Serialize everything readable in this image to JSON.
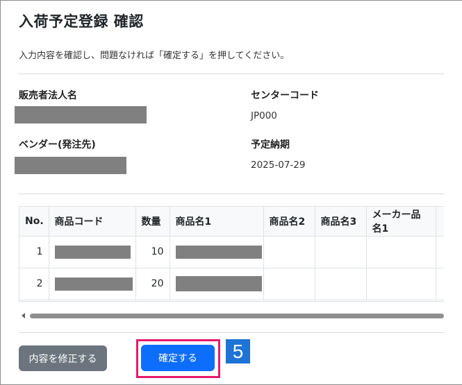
{
  "page": {
    "title": "入荷予定登録 確認",
    "lead": "入力内容を確認し、問題なければ「確定する」を押してください。"
  },
  "fields": {
    "seller_label": "販売者法人名",
    "center_code_label": "センターコード",
    "center_code_value": "JP000",
    "vendor_label": "ベンダー(発注先)",
    "due_date_label": "予定納期",
    "due_date_value": "2025-07-29"
  },
  "table": {
    "headers": [
      "No.",
      "商品コード",
      "数量",
      "商品名1",
      "商品名2",
      "商品名3",
      "メーカー品名1"
    ],
    "rows": [
      {
        "no": "1",
        "qty": "10"
      },
      {
        "no": "2",
        "qty": "20"
      }
    ]
  },
  "buttons": {
    "edit_label": "内容を修正する",
    "confirm_label": "確定する"
  },
  "annotation": {
    "step_number": "5",
    "highlight_color": "#e6196f",
    "step_color": "#1e73d6"
  },
  "colors": {
    "primary": "#0d6efd",
    "secondary": "#6c757d"
  }
}
